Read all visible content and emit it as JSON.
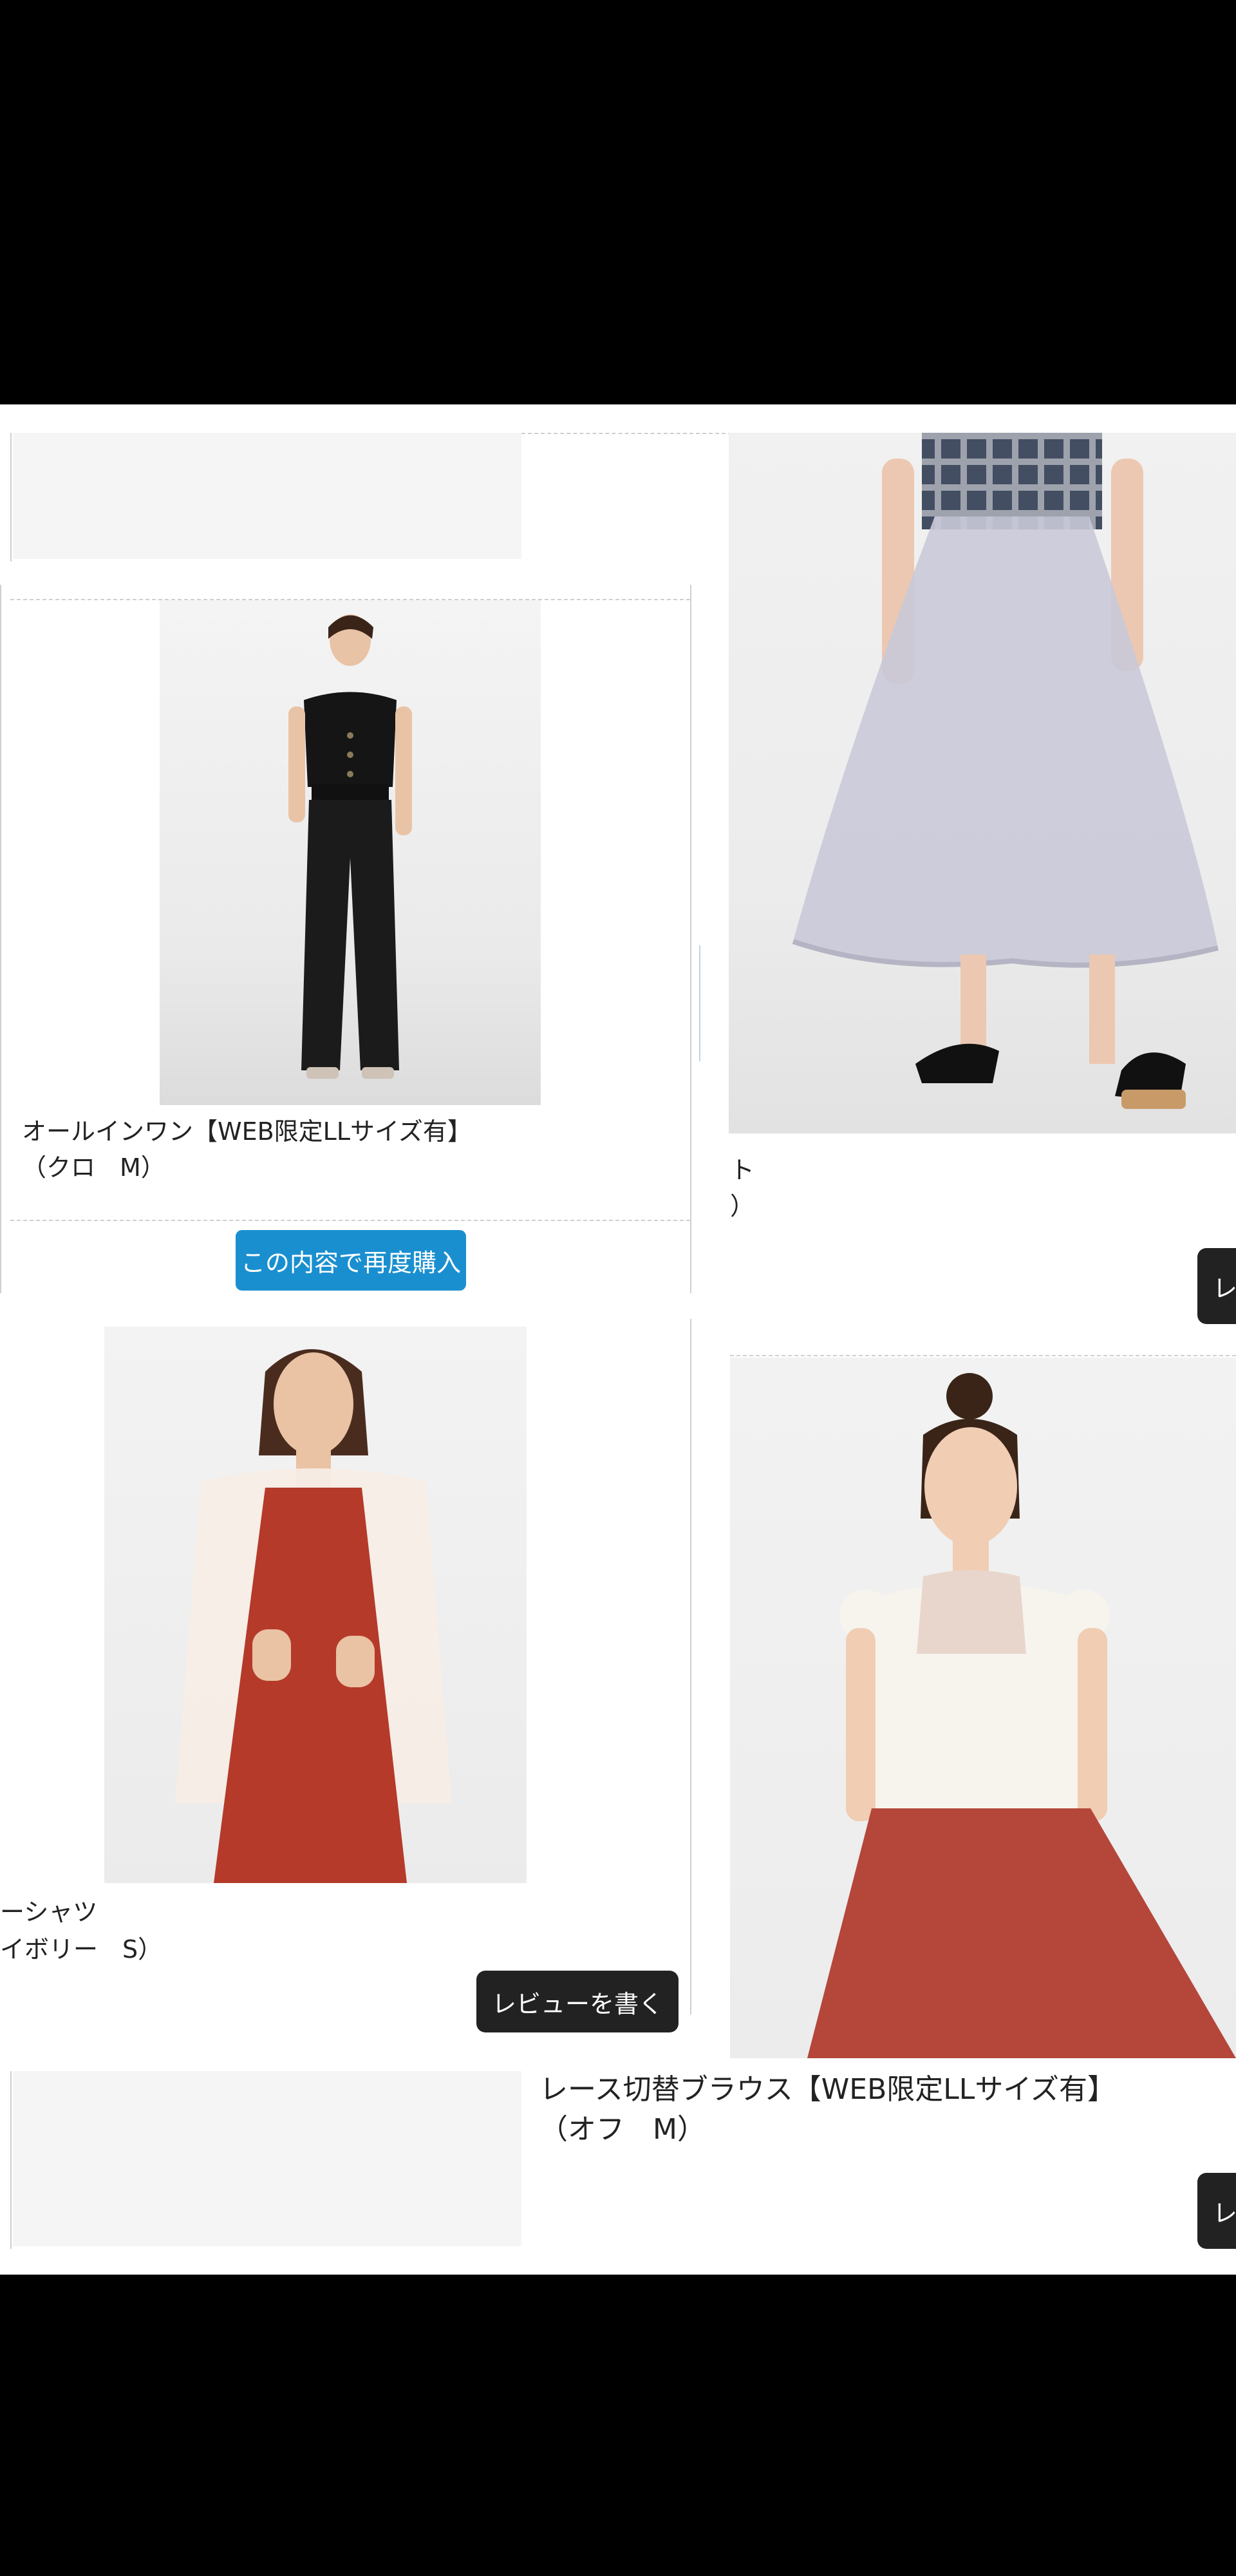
{
  "products": [
    {
      "name": "オールインワン【WEB限定LLサイズ有】",
      "variant": "（クロ　M）",
      "action_label": "この内容で再度購入"
    },
    {
      "name": "ト",
      "variant": "）",
      "action_label": "レ"
    },
    {
      "name": "ーシャツ",
      "variant": "イボリー　S）",
      "action_label": "レビューを書く"
    },
    {
      "name": "レース切替ブラウス【WEB限定LLサイズ有】",
      "variant": "（オフ　M）",
      "action_label": "レ"
    }
  ],
  "colors": {
    "top_bar": "#000000",
    "page_bg": "#ffffff",
    "buy_button": "#1a8fd0",
    "review_button": "#222222",
    "divider": "#cfcfcf"
  }
}
